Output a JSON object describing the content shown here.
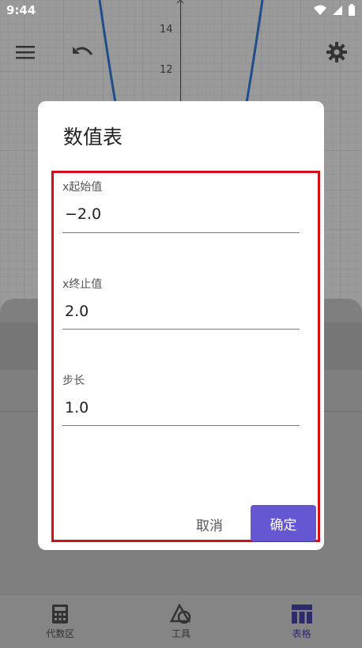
{
  "status_bar": {
    "time": "9:44"
  },
  "graph": {
    "y_ticks": [
      "14",
      "12"
    ]
  },
  "dialog": {
    "title": "数值表",
    "fields": [
      {
        "label": "x起始值",
        "value": "−2.0"
      },
      {
        "label": "x终止值",
        "value": "2.0"
      },
      {
        "label": "步长",
        "value": "1.0"
      }
    ],
    "cancel_label": "取消",
    "confirm_label": "确定",
    "accent_color": "#6557d2",
    "highlight_color": "#d0101a"
  },
  "bottom_nav": {
    "items": [
      {
        "label": "代数区",
        "icon": "calculator-icon"
      },
      {
        "label": "工具",
        "icon": "shapes-icon"
      },
      {
        "label": "表格",
        "icon": "table-icon"
      }
    ],
    "active_index": 2
  }
}
